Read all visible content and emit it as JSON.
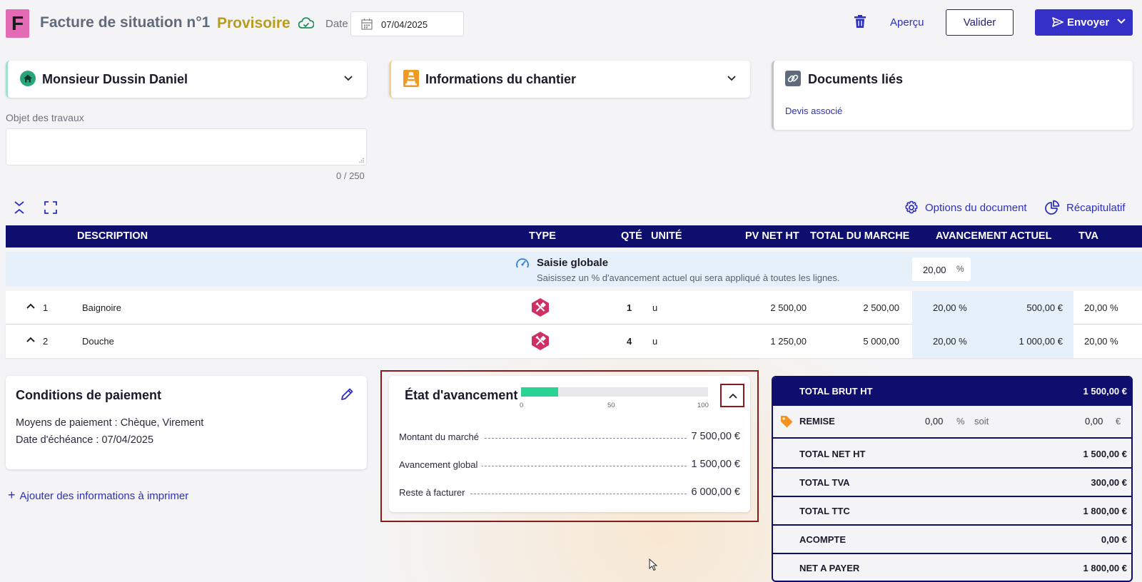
{
  "header": {
    "logo_letter": "F",
    "title": "Facture de situation n°1",
    "status": "Provisoire",
    "date_label": "Date",
    "date_value": "07/04/2025",
    "apercu_label": "Aperçu",
    "valider_label": "Valider",
    "envoyer_label": "Envoyer"
  },
  "client": {
    "name": "Monsieur Dussin Daniel"
  },
  "chantier": {
    "title": "Informations du chantier"
  },
  "documents": {
    "title": "Documents liés",
    "link": "Devis associé"
  },
  "objet": {
    "label": "Objet des travaux",
    "value": "",
    "counter": "0 / 250"
  },
  "toolbar": {
    "options_label": "Options du document",
    "recap_label": "Récapitulatif"
  },
  "table": {
    "headers": {
      "description": "DESCRIPTION",
      "type": "TYPE",
      "qte": "QTÉ",
      "unite": "UNITÉ",
      "pv": "PV NET HT",
      "total": "TOTAL DU MARCHE",
      "avancement": "AVANCEMENT ACTUEL",
      "tva": "TVA"
    },
    "saisie": {
      "title": "Saisie globale",
      "subtitle": "Saisissez un % d'avancement actuel qui sera appliqué à toutes les lignes.",
      "value": "20,00",
      "unit": "%"
    },
    "rows": [
      {
        "num": "1",
        "description": "Baignoire",
        "qte": "1",
        "unite": "u",
        "pv": "2 500,00",
        "total": "2 500,00",
        "pct": "20,00 %",
        "amount": "500,00 €",
        "tva": "20,00 %"
      },
      {
        "num": "2",
        "description": "Douche",
        "qte": "4",
        "unite": "u",
        "pv": "1 250,00",
        "total": "5 000,00",
        "pct": "20,00 %",
        "amount": "1 000,00 €",
        "tva": "20,00 %"
      }
    ]
  },
  "payment": {
    "title": "Conditions de paiement",
    "means": "Moyens de paiement : Chèque, Virement",
    "due": "Date d'échéance : 07/04/2025",
    "add_info": "Ajouter des informations à imprimer"
  },
  "progress": {
    "title": "État d'avancement",
    "percent": 20,
    "ticks": [
      "0",
      "50",
      "100"
    ],
    "rows": [
      {
        "label": "Montant du marché",
        "value": "7 500,00 €"
      },
      {
        "label": "Avancement global",
        "value": "1 500,00 €"
      },
      {
        "label": "Reste à facturer",
        "value": "6 000,00 €"
      }
    ]
  },
  "totals": {
    "brut_label": "TOTAL BRUT HT",
    "brut_value": "1 500,00 €",
    "remise_label": "REMISE",
    "remise_pct": "0,00",
    "remise_pct_unit": "%",
    "remise_soit": "soit",
    "remise_amount": "0,00",
    "remise_currency": "€",
    "net_label": "TOTAL NET HT",
    "net_value": "1 500,00 €",
    "tva_label": "TOTAL TVA",
    "tva_value": "300,00 €",
    "ttc_label": "TOTAL TTC",
    "ttc_value": "1 800,00 €",
    "acompte_label": "ACOMPTE",
    "acompte_value": "0,00 €",
    "payer_label": "NET A PAYER",
    "payer_value": "1 800,00 €"
  },
  "colors": {
    "navy": "#0e0e6e",
    "accent": "#3530c8",
    "status": "#b89c1f",
    "progress": "#2ad394",
    "highlight": "#8b1a1a",
    "logo": "#e26bb3"
  },
  "icons": [
    "cloud-icon",
    "calendar-icon",
    "trash-icon",
    "send-icon",
    "house-icon",
    "cone-icon",
    "link-icon",
    "gear-icon",
    "pie-icon",
    "gauge-icon",
    "tools-icon",
    "pencil-icon",
    "tag-icon",
    "chevron-down-icon",
    "chevron-up-icon"
  ]
}
